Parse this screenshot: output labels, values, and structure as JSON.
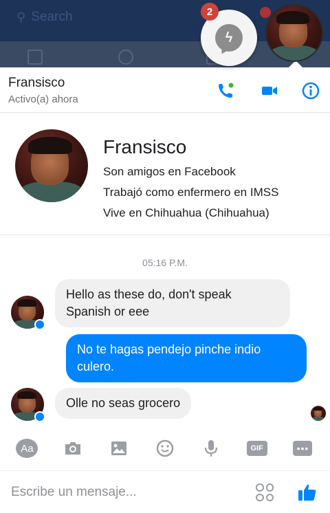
{
  "background": {
    "search_placeholder": "Search"
  },
  "chat_heads": {
    "messenger_badge": "2"
  },
  "header": {
    "name": "Fransisco",
    "status": "Activo(a) ahora"
  },
  "profile": {
    "name": "Fransisco",
    "lines": [
      "Son amigos en Facebook",
      "Trabajó como enfermero en IMSS",
      "Vive en Chihuahua (Chihuahua)"
    ]
  },
  "conversation": {
    "timestamp": "05:16 P.M.",
    "messages": [
      {
        "from": "them",
        "text": "Hello as these do, don't speak Spanish or eee"
      },
      {
        "from": "me",
        "text": "No te hagas pendejo pinche indio culero."
      },
      {
        "from": "them",
        "text": "Olle no seas grocero"
      }
    ]
  },
  "toolbar": {
    "aa_label": "Aa",
    "gif_label": "GIF",
    "more_label": "•••"
  },
  "composer": {
    "placeholder": "Escribe un mensaje..."
  },
  "colors": {
    "accent": "#0084ff",
    "incoming_bubble": "#f1f0f0",
    "badge": "#d0433a"
  },
  "icons": [
    "search-icon",
    "messenger-icon",
    "phone-icon",
    "video-icon",
    "info-icon",
    "camera-icon",
    "image-icon",
    "emoji-icon",
    "mic-icon",
    "gif-icon",
    "more-icon",
    "sticker-icon",
    "like-icon"
  ]
}
